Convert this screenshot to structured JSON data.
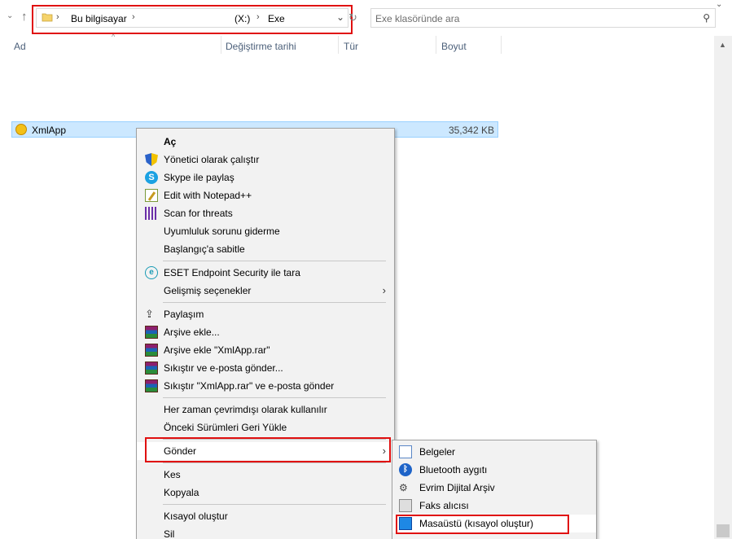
{
  "address_bar": {
    "crumbs": [
      "Bu bilgisayar",
      "(X:)",
      "Exe"
    ],
    "search_placeholder": "Exe klasöründe ara"
  },
  "columns": [
    "Ad",
    "Değiştirme tarihi",
    "Tür",
    "Boyut"
  ],
  "file": {
    "name": "XmlApp",
    "size": "35,342 KB"
  },
  "context_menu": {
    "items": [
      {
        "label": "Aç",
        "icon": "none",
        "bold": true
      },
      {
        "label": "Yönetici olarak çalıştır",
        "icon": "shield-icon"
      },
      {
        "label": "Skype ile paylaş",
        "icon": "skype-icon"
      },
      {
        "label": "Edit with Notepad++",
        "icon": "notepad-icon"
      },
      {
        "label": "Scan for threats",
        "icon": "scan-icon"
      },
      {
        "label": "Uyumluluk sorunu giderme",
        "icon": "none"
      },
      {
        "label": "Başlangıç'a sabitle",
        "icon": "none"
      },
      {
        "label": "ESET Endpoint Security ile tara",
        "icon": "eset-icon"
      },
      {
        "label": "Gelişmiş seçenekler",
        "icon": "none",
        "submenu": true
      },
      {
        "label": "Paylaşım",
        "icon": "share-icon"
      },
      {
        "label": "Arşive ekle...",
        "icon": "winrar-icon"
      },
      {
        "label": "Arşive ekle \"XmlApp.rar\"",
        "icon": "winrar-icon"
      },
      {
        "label": "Sıkıştır ve e-posta gönder...",
        "icon": "winrar-icon"
      },
      {
        "label": "Sıkıştır \"XmlApp.rar\" ve e-posta gönder",
        "icon": "winrar-icon"
      },
      {
        "label": "Her zaman çevrimdışı olarak kullanılır",
        "icon": "none"
      },
      {
        "label": "Önceki Sürümleri Geri Yükle",
        "icon": "none"
      },
      {
        "label": "Gönder",
        "icon": "none",
        "submenu": true
      },
      {
        "label": "Kes",
        "icon": "none"
      },
      {
        "label": "Kopyala",
        "icon": "none"
      },
      {
        "label": "Kısayol oluştur",
        "icon": "none"
      },
      {
        "label": "Sil",
        "icon": "none"
      }
    ]
  },
  "send_to_menu": {
    "items": [
      {
        "label": "Belgeler",
        "icon": "document-icon"
      },
      {
        "label": "Bluetooth aygıtı",
        "icon": "bluetooth-icon"
      },
      {
        "label": "Evrim Dijital Arşiv",
        "icon": "archive-icon"
      },
      {
        "label": "Faks alıcısı",
        "icon": "fax-icon"
      },
      {
        "label": "Masaüstü (kısayol oluştur)",
        "icon": "desktop-icon",
        "hovered": true
      }
    ]
  },
  "colors": {
    "selection_bg": "#cce8ff",
    "menu_bg": "#f2f2f2",
    "highlight_box": "#e01010"
  }
}
